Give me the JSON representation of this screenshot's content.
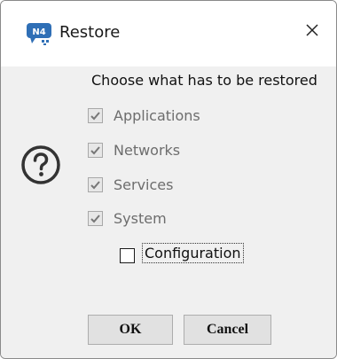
{
  "window": {
    "title": "Restore",
    "app_icon": "nx-app-icon",
    "close_icon": "close-icon"
  },
  "dialog": {
    "prompt": "Choose what has to be restored",
    "help_icon": "question-circle-icon",
    "options": [
      {
        "label": "Applications",
        "checked": true,
        "enabled": false
      },
      {
        "label": "Networks",
        "checked": true,
        "enabled": false
      },
      {
        "label": "Services",
        "checked": true,
        "enabled": false
      },
      {
        "label": "System",
        "checked": true,
        "enabled": false
      }
    ],
    "sub_option": {
      "label": "Configuration",
      "checked": false,
      "enabled": true,
      "focused": true
    }
  },
  "buttons": {
    "ok": "OK",
    "cancel": "Cancel"
  },
  "colors": {
    "dialog_bg": "#f0f0f0",
    "titlebar_bg": "#ffffff",
    "disabled_text": "#6d6d6d",
    "app_icon_blue": "#2f6fb6"
  }
}
